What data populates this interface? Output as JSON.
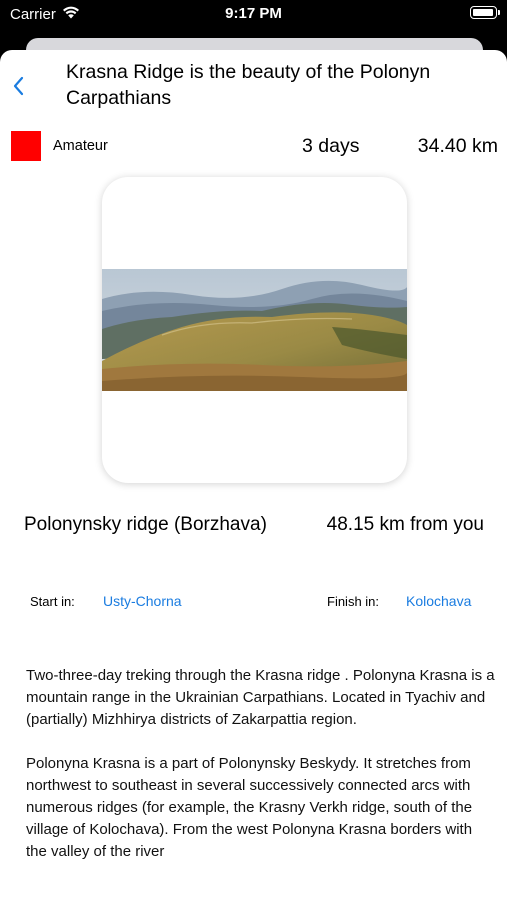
{
  "status_bar": {
    "carrier": "Carrier",
    "time": "9:17 PM"
  },
  "header": {
    "title": "Krasna Ridge is the beauty of the Polonyn Carpathians"
  },
  "route": {
    "level": "Amateur",
    "level_color": "#ff0000",
    "duration": "3 days",
    "distance": "34.40 km",
    "region": "Polonynsky ridge (Borzhava)",
    "distance_from_user": "48.15 km from you",
    "start_label": "Start in:",
    "start_place": "Usty-Chorna",
    "finish_label": "Finish in:",
    "finish_place": "Kolochava",
    "link_color": "#1a7ce0"
  },
  "description": {
    "paragraphs": [
      "Two-three-day treking through the Krasna ridge . Polonyna Krasna is a mountain range in the Ukrainian Carpathians. Located in Tyachiv and (partially) Mizhhirya districts of Zakarpattia region.",
      "Polonyna Krasna is a part of Polonynsky Beskydy. It stretches from northwest to southeast in several successively connected arcs with numerous ridges (for example, the Krasny Verkh ridge, south of the village of Kolochava). From the west Polonyna Krasna borders with the valley of the river"
    ]
  }
}
